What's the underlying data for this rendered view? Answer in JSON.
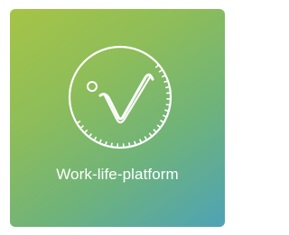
{
  "tile": {
    "label": "Work-life-platform",
    "icon": "checkmark-circle-icon",
    "gradient_colors": [
      "#a6c446",
      "#6fb37a",
      "#4ea3b6"
    ],
    "text_color": "#ffffff"
  }
}
